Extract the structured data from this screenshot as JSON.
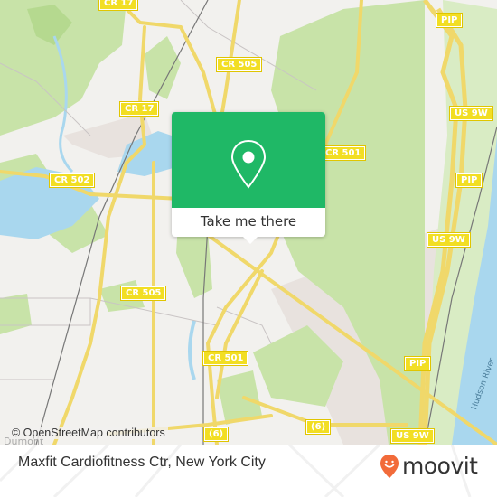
{
  "map": {
    "attribution": "© OpenStreetMap contributors",
    "colors": {
      "background": "#f2f1ee",
      "park": "#c8e3a8",
      "water": "#a9d7ee",
      "road": "#f7e07a",
      "urban": "#e8e2de",
      "shield": "#f2de23",
      "accent": "#1fb866"
    },
    "road_labels": [
      {
        "id": "cr17-top",
        "text": "CR 17"
      },
      {
        "id": "cr505-top",
        "text": "CR 505"
      },
      {
        "id": "cr17-mid",
        "text": "CR 17"
      },
      {
        "id": "cr502",
        "text": "CR 502"
      },
      {
        "id": "cr501-right",
        "text": "CR 501"
      },
      {
        "id": "cr505-mid",
        "text": "CR 505"
      },
      {
        "id": "cr501-low",
        "text": "CR 501"
      },
      {
        "id": "pip-top",
        "text": "PIP"
      },
      {
        "id": "us9w-1",
        "text": "US 9W"
      },
      {
        "id": "pip-2",
        "text": "PIP"
      },
      {
        "id": "us9w-2",
        "text": "US 9W"
      },
      {
        "id": "pip-3",
        "text": "PIP"
      },
      {
        "id": "rt6-left",
        "text": "(6)"
      },
      {
        "id": "rt6-mid",
        "text": "(6)"
      },
      {
        "id": "us9w-3",
        "text": "US 9W"
      }
    ],
    "place_labels": {
      "river": "Hudson River",
      "town": "Dumont"
    }
  },
  "popup": {
    "icon": "map-pin-icon",
    "button_label": "Take me there"
  },
  "footer": {
    "title": "Maxfit Cardiofitness Ctr, New York City",
    "brand": "moovit",
    "brand_icon": "moovit-smile-pin-icon",
    "brand_color": "#f26b3a"
  }
}
